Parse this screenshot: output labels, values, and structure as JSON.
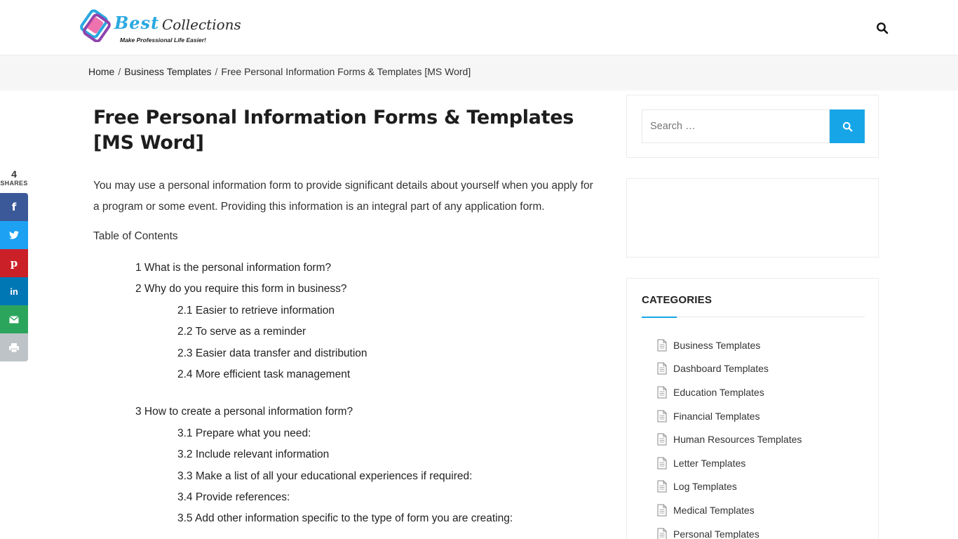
{
  "header": {
    "logo_word1": "Best",
    "logo_word2": "Collections",
    "logo_tagline": "Make Professional Life Easier!",
    "search_icon": "search-icon"
  },
  "breadcrumb": {
    "items": [
      "Home",
      "Business Templates"
    ],
    "current": "Free Personal Information Forms & Templates [MS Word]",
    "separator": "/"
  },
  "share": {
    "count": "4",
    "label": "SHARES",
    "buttons": [
      {
        "name": "facebook",
        "glyph": "f"
      },
      {
        "name": "twitter",
        "glyph": "t"
      },
      {
        "name": "pinterest",
        "glyph": "p"
      },
      {
        "name": "linkedin",
        "glyph": "in"
      },
      {
        "name": "email",
        "glyph": "✉"
      },
      {
        "name": "print",
        "glyph": "⎙"
      }
    ]
  },
  "article": {
    "title": "Free Personal Information Forms & Templates [MS Word]",
    "intro": "You may use a personal information form to provide significant details about yourself when you apply for a program or some event. Providing this information is an integral part of any application form.",
    "toc_title": "Table of Contents",
    "toc": [
      {
        "level": 1,
        "text": "1 What is the personal information form?"
      },
      {
        "level": 1,
        "text": "2 Why do you require this form in business?"
      },
      {
        "level": 2,
        "text": "2.1 Easier to retrieve information"
      },
      {
        "level": 2,
        "text": "2.2 To serve as a reminder"
      },
      {
        "level": 2,
        "text": "2.3 Easier data transfer and distribution"
      },
      {
        "level": 2,
        "text": "2.4 More efficient task management"
      },
      {
        "level": 1,
        "text": "3 How to create a personal information form?"
      },
      {
        "level": 2,
        "text": "3.1 Prepare what you need:"
      },
      {
        "level": 2,
        "text": "3.2 Include relevant information"
      },
      {
        "level": 2,
        "text": "3.3 Make a list of all your educational experiences if required:"
      },
      {
        "level": 2,
        "text": "3.4 Provide references:"
      },
      {
        "level": 2,
        "text": "3.5 Add other information specific to the type of form you are creating:"
      }
    ]
  },
  "sidebar": {
    "search_placeholder": "Search …",
    "categories_title": "CATEGORIES",
    "categories": [
      "Business Templates",
      "Dashboard Templates",
      "Education Templates",
      "Financial Templates",
      "Human Resources Templates",
      "Letter Templates",
      "Log Templates",
      "Medical Templates",
      "Personal Templates"
    ]
  },
  "colors": {
    "accent": "#16a6e8",
    "facebook": "#3b5998",
    "twitter": "#1da1f2",
    "pinterest": "#cb2027",
    "linkedin": "#0077b5",
    "email": "#2ca55c",
    "print": "#bdc3c7"
  }
}
